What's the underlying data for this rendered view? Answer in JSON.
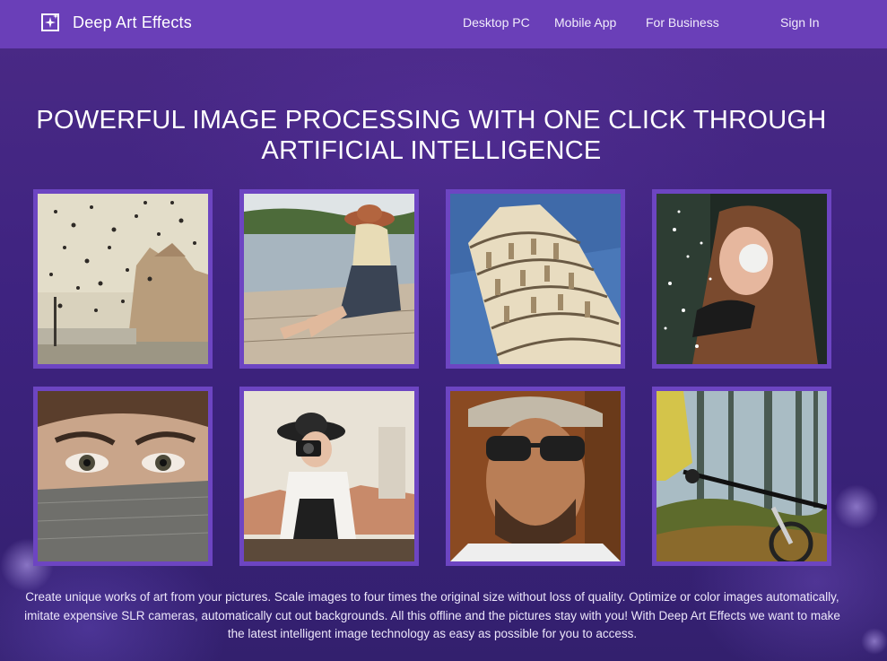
{
  "header": {
    "brand_name": "Deep Art Effects",
    "brand_icon": "sparkle-frame-icon",
    "nav": [
      "Desktop PC",
      "Mobile App",
      "For Business"
    ],
    "sign_in": "Sign In",
    "background_color": "#6a3fb8"
  },
  "hero": {
    "title": "POWERFUL IMAGE PROCESSING WITH ONE CLICK THROUGH ARTIFICIAL INTELLIGENCE"
  },
  "gallery": {
    "frame_color": "#6d45c2",
    "tiles": [
      {
        "name": "birds-over-palace-image"
      },
      {
        "name": "woman-on-pier-image"
      },
      {
        "name": "leaning-tower-image"
      },
      {
        "name": "woman-blowing-snow-image"
      },
      {
        "name": "eyes-behind-scarf-image"
      },
      {
        "name": "photographer-woman-image"
      },
      {
        "name": "man-with-sunglasses-image"
      },
      {
        "name": "mountain-bike-forest-image"
      }
    ]
  },
  "description": "Create unique works of art from your pictures. Scale images to four times the original size without loss of quality. Optimize or color images automatically, imitate expensive SLR cameras, automatically cut out backgrounds. All this offline and the pictures stay with you! With Deep Art Effects we want to make the latest intelligent image technology as easy as possible for you to access."
}
